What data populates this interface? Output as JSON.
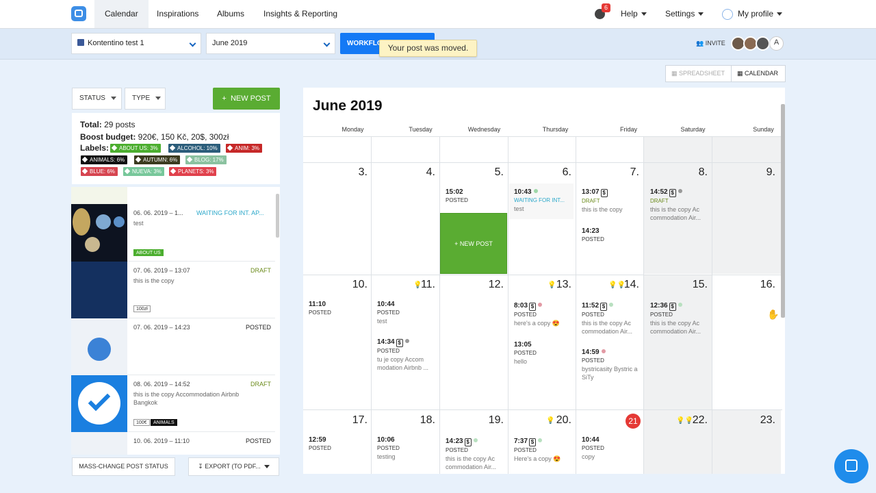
{
  "nav": {
    "tabs": [
      "Calendar",
      "Inspirations",
      "Albums",
      "Insights & Reporting"
    ],
    "notif_count": "6",
    "help": "Help",
    "settings": "Settings",
    "profile": "My profile"
  },
  "toolbar": {
    "page_select": "Kontentino test 1",
    "month_select": "June 2019",
    "workflow_button": "WORKFLOW",
    "toast": "Your post was moved.",
    "invite": "INVITE",
    "avatar_letter": "A"
  },
  "view": {
    "spreadsheet": "SPREADSHEET",
    "calendar": "CALENDAR"
  },
  "filters": {
    "status": "STATUS",
    "type": "TYPE",
    "new_post": "NEW POST"
  },
  "summary": {
    "total_label": "Total:",
    "total_value": "29 posts",
    "boost_label": "Boost budget:",
    "boost_value": "920€, 150 Kč, 20$, 300zł",
    "labels_label": "Labels:",
    "labels": [
      {
        "text": "ABOUT US: 3%",
        "color": "#4cae2f"
      },
      {
        "text": "ALCOHOL: 10%",
        "color": "#2b5d7a"
      },
      {
        "text": "ANIM: 3%",
        "color": "#c62828"
      },
      {
        "text": "ANIMALS: 6%",
        "color": "#111111"
      },
      {
        "text": "AUTUMN: 6%",
        "color": "#3b3b1f"
      },
      {
        "text": "BLOG: 17%",
        "color": "#8bc2a0"
      },
      {
        "text": "BLUE: 6%",
        "color": "#d64550"
      },
      {
        "text": "NUEVA: 3%",
        "color": "#77c79a"
      },
      {
        "text": "PLANETS: 3%",
        "color": "#e0414c"
      }
    ]
  },
  "posts": [
    {
      "date": "06. 06. 2019 – 1...",
      "status": "WAITING FOR INT. AP...",
      "text": "test",
      "tags": [
        "ABOUT US"
      ]
    },
    {
      "date": "07. 06. 2019 – 13:07",
      "status": "DRAFT",
      "text": "this is the copy",
      "tags": [
        "100zł"
      ]
    },
    {
      "date": "07. 06. 2019 – 14:23",
      "status": "POSTED",
      "text": "",
      "tags": []
    },
    {
      "date": "08. 06. 2019 – 14:52",
      "status": "DRAFT",
      "text": "this is the copy Accommodation Airbnb Bangkok",
      "tags": [
        "100€",
        "ANIMALS"
      ]
    },
    {
      "date": "10. 06. 2019 – 11:10",
      "status": "POSTED",
      "text": "",
      "tags": []
    }
  ],
  "bottom": {
    "mass_change": "MASS-CHANGE POST STATUS",
    "export": "EXPORT (TO PDF..."
  },
  "calendar": {
    "title": "June 2019",
    "days": [
      "Monday",
      "Tuesday",
      "Wednesday",
      "Thursday",
      "Friday",
      "Saturday",
      "Sunday"
    ],
    "new_post_cell": "+ NEW POST",
    "week1": [
      "3.",
      "4.",
      "5.",
      "6.",
      "7.",
      "8.",
      "9."
    ],
    "week2": [
      "10.",
      "11.",
      "12.",
      "13.",
      "14.",
      "15.",
      "16."
    ],
    "week3": [
      "17.",
      "18.",
      "19.",
      "20.",
      "21",
      "22.",
      "23."
    ],
    "events": {
      "d5": [
        {
          "time": "15:02",
          "status": "POSTED",
          "text": ""
        }
      ],
      "d6": [
        {
          "time": "10:43",
          "status": "WAITING FOR INT...",
          "text": "test"
        }
      ],
      "d7": [
        {
          "time": "13:07",
          "status": "DRAFT",
          "text": "this is the copy"
        },
        {
          "time": "14:23",
          "status": "POSTED",
          "text": ""
        }
      ],
      "d8": [
        {
          "time": "14:52",
          "status": "DRAFT",
          "text": "this is the copy Ac commodation Air..."
        }
      ],
      "d10": [
        {
          "time": "11:10",
          "status": "POSTED",
          "text": ""
        }
      ],
      "d11": [
        {
          "time": "10:44",
          "status": "POSTED",
          "text": "test"
        },
        {
          "time": "14:34",
          "status": "POSTED",
          "text": "tu je copy Accom modation Airbnb ..."
        }
      ],
      "d13": [
        {
          "time": "8:03",
          "status": "POSTED",
          "text": "here's a copy 😍"
        },
        {
          "time": "13:05",
          "status": "POSTED",
          "text": "hello"
        }
      ],
      "d14": [
        {
          "time": "11:52",
          "status": "POSTED",
          "text": "this is the copy Ac commodation Air..."
        },
        {
          "time": "14:59",
          "status": "POSTED",
          "text": "bystricasity Bystric a SiTy"
        }
      ],
      "d15": [
        {
          "time": "12:36",
          "status": "POSTED",
          "text": "this is the copy Ac commodation Air..."
        }
      ],
      "d17": [
        {
          "time": "12:59",
          "status": "POSTED",
          "text": ""
        }
      ],
      "d18": [
        {
          "time": "10:06",
          "status": "POSTED",
          "text": "testing"
        }
      ],
      "d19": [
        {
          "time": "14:23",
          "status": "POSTED",
          "text": "this is the copy Ac commodation Air..."
        }
      ],
      "d20": [
        {
          "time": "7:37",
          "status": "POSTED",
          "text": "Here's a copy 😍"
        }
      ],
      "d21": [
        {
          "time": "10:44",
          "status": "POSTED",
          "text": "copy"
        }
      ]
    }
  }
}
